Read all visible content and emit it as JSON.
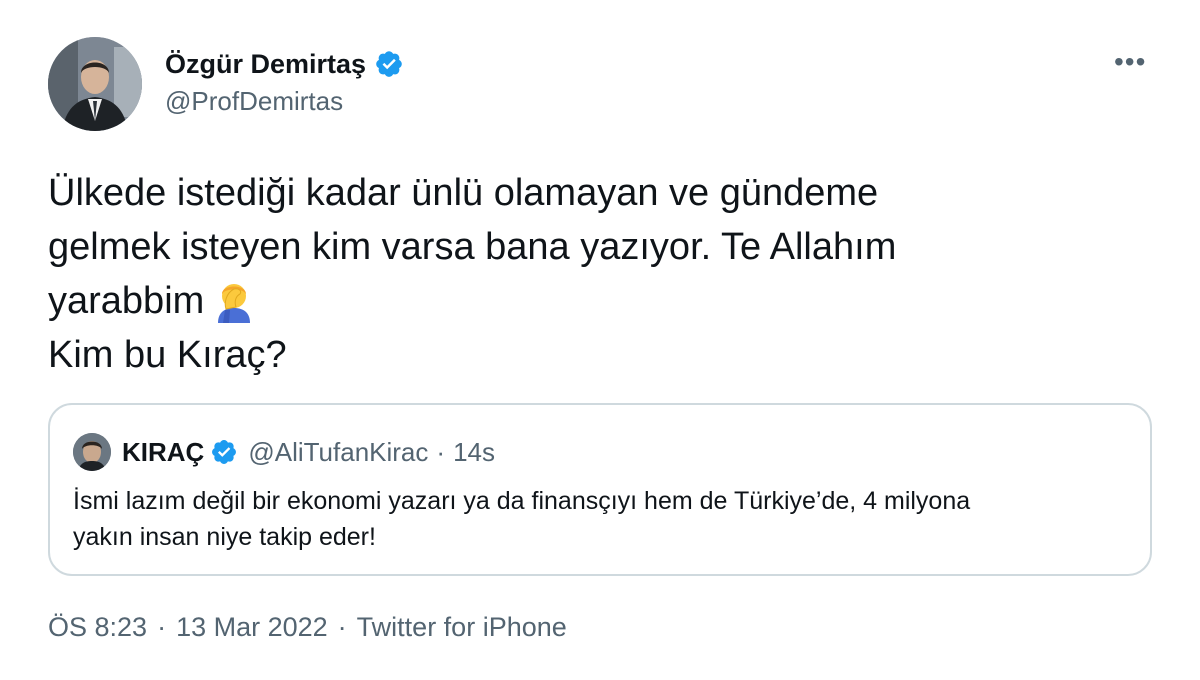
{
  "author": {
    "name": "Özgür Demirtaş",
    "handle": "@ProfDemirtas"
  },
  "tweet": {
    "lines": [
      "Ülkede istediği kadar ünlü olamayan ve gündeme",
      "gelmek isteyen kim varsa bana yazıyor. Te Allahım",
      "yarabbim",
      "Kim bu Kıraç?"
    ],
    "emoji_icon": "facepalm-icon"
  },
  "quoted": {
    "name": "KIRAÇ",
    "handle": "@AliTufanKirac",
    "separator": "·",
    "time": "14s",
    "lines": [
      "İsmi lazım değil bir ekonomi yazarı ya da finansçıyı hem de Türkiye’de, 4 milyona",
      "yakın insan niye takip eder!"
    ]
  },
  "meta": {
    "time": "ÖS 8:23",
    "date": "13 Mar 2022",
    "source": "Twitter for iPhone",
    "separator": "·"
  },
  "more_label": "•••",
  "colors": {
    "verified_blue": "#1d9bf0",
    "secondary_text": "#536471",
    "primary_text": "#0f1419",
    "border": "#cfd9de"
  }
}
